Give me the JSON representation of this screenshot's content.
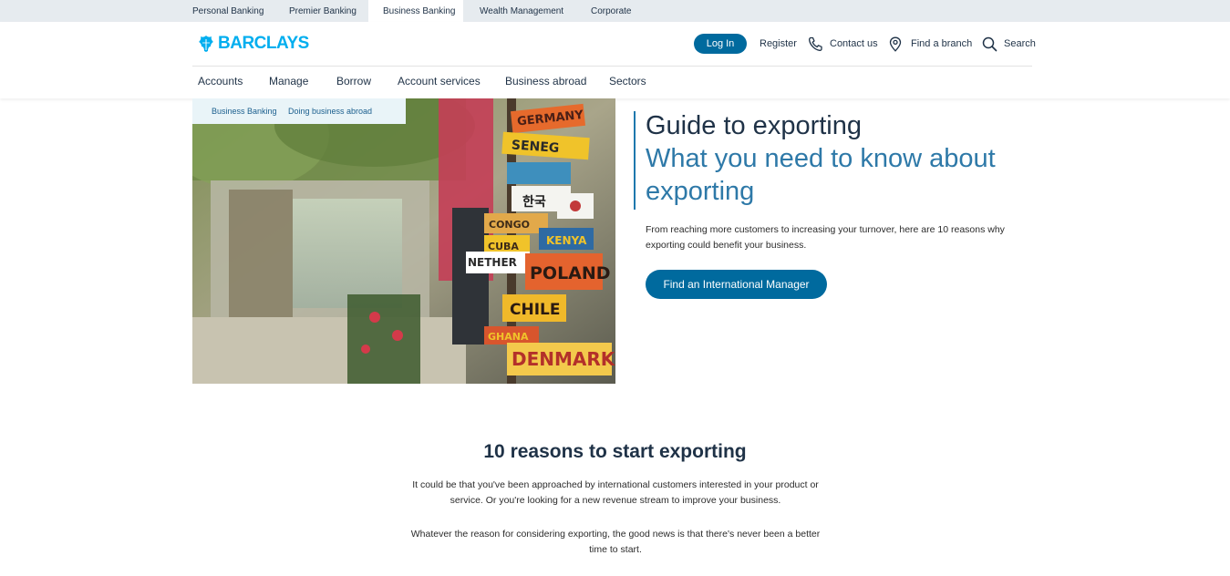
{
  "segments": [
    "Personal Banking",
    "Premier Banking",
    "Business Banking",
    "Wealth Management",
    "Corporate"
  ],
  "active_segment": "Business Banking",
  "logo": {
    "text": "BARCLAYS"
  },
  "header_actions": {
    "login": "Log In",
    "register": "Register",
    "contact": "Contact us",
    "branch": "Find a branch",
    "search": "Search"
  },
  "nav": [
    "Accounts",
    "Manage",
    "Borrow",
    "Account services",
    "Business abroad",
    "Sectors"
  ],
  "breadcrumb": [
    "Business Banking",
    "Doing business abroad"
  ],
  "hero": {
    "title": "Guide to exporting",
    "subtitle_line1": "What you need to know about",
    "subtitle_line2": "exporting",
    "description": "From reaching more customers to increasing your turnover, here are 10 reasons why exporting could benefit your business.",
    "cta": "Find an International Manager",
    "image_signs": [
      "GERMANY",
      "SENEG",
      "한국",
      "CUBA",
      "NETHER",
      "POLAND",
      "CHILE",
      "GHANA",
      "DENMARK",
      "KENYA",
      "CONGO"
    ]
  },
  "reasons": {
    "title": "10 reasons to start exporting",
    "p1": "It could be that you've been approached by international customers interested in your product or service. Or you're looking for a new revenue stream to improve your business.",
    "p2": "Whatever the reason for considering exporting, the good news is that there's never been a better time to start."
  },
  "colors": {
    "brand_blue": "#00aeef",
    "button_blue": "#006a9e",
    "heading_navy": "#1f3247",
    "subtitle_blue": "#2e79a8",
    "segbar_bg": "#e6ebef",
    "breadcrumb_bg": "#e9f4f8"
  },
  "icons": [
    "eagle-logo-icon",
    "phone-icon",
    "location-pin-icon",
    "search-icon"
  ]
}
